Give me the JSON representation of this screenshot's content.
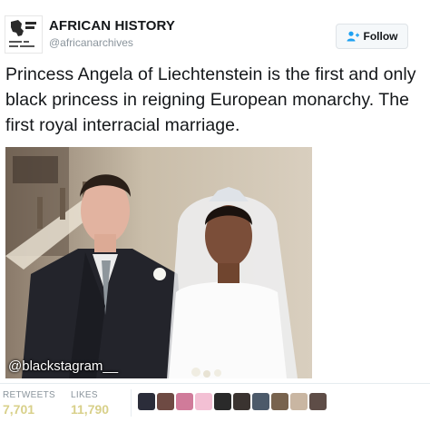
{
  "account": {
    "name": "AFRICAN HISTORY",
    "handle": "@africanarchives",
    "avatar_icon": "african-history-logo"
  },
  "follow_button": {
    "label": "Follow",
    "icon": "add-user-icon"
  },
  "tweet": {
    "text": "Princess Angela of Liechtenstein is the first and only black princess in reigning European monarchy. The first royal interracial marriage."
  },
  "photo": {
    "watermark": "@blackstagram__"
  },
  "stats": {
    "retweets_label": "RETWEETS",
    "retweets_value": "7,701",
    "likes_label": "LIKES",
    "likes_value": "11,790"
  },
  "likers": {
    "colors": [
      "#2b2d3a",
      "#6e4a43",
      "#d07b9a",
      "#f3c0d4",
      "#2a2a2a",
      "#3a3330",
      "#4c5a6a",
      "#78634e",
      "#c9b6a2",
      "#5e4d47"
    ]
  },
  "colors": {
    "stat_value": "#d8d08a",
    "muted_text": "#8a949c"
  }
}
